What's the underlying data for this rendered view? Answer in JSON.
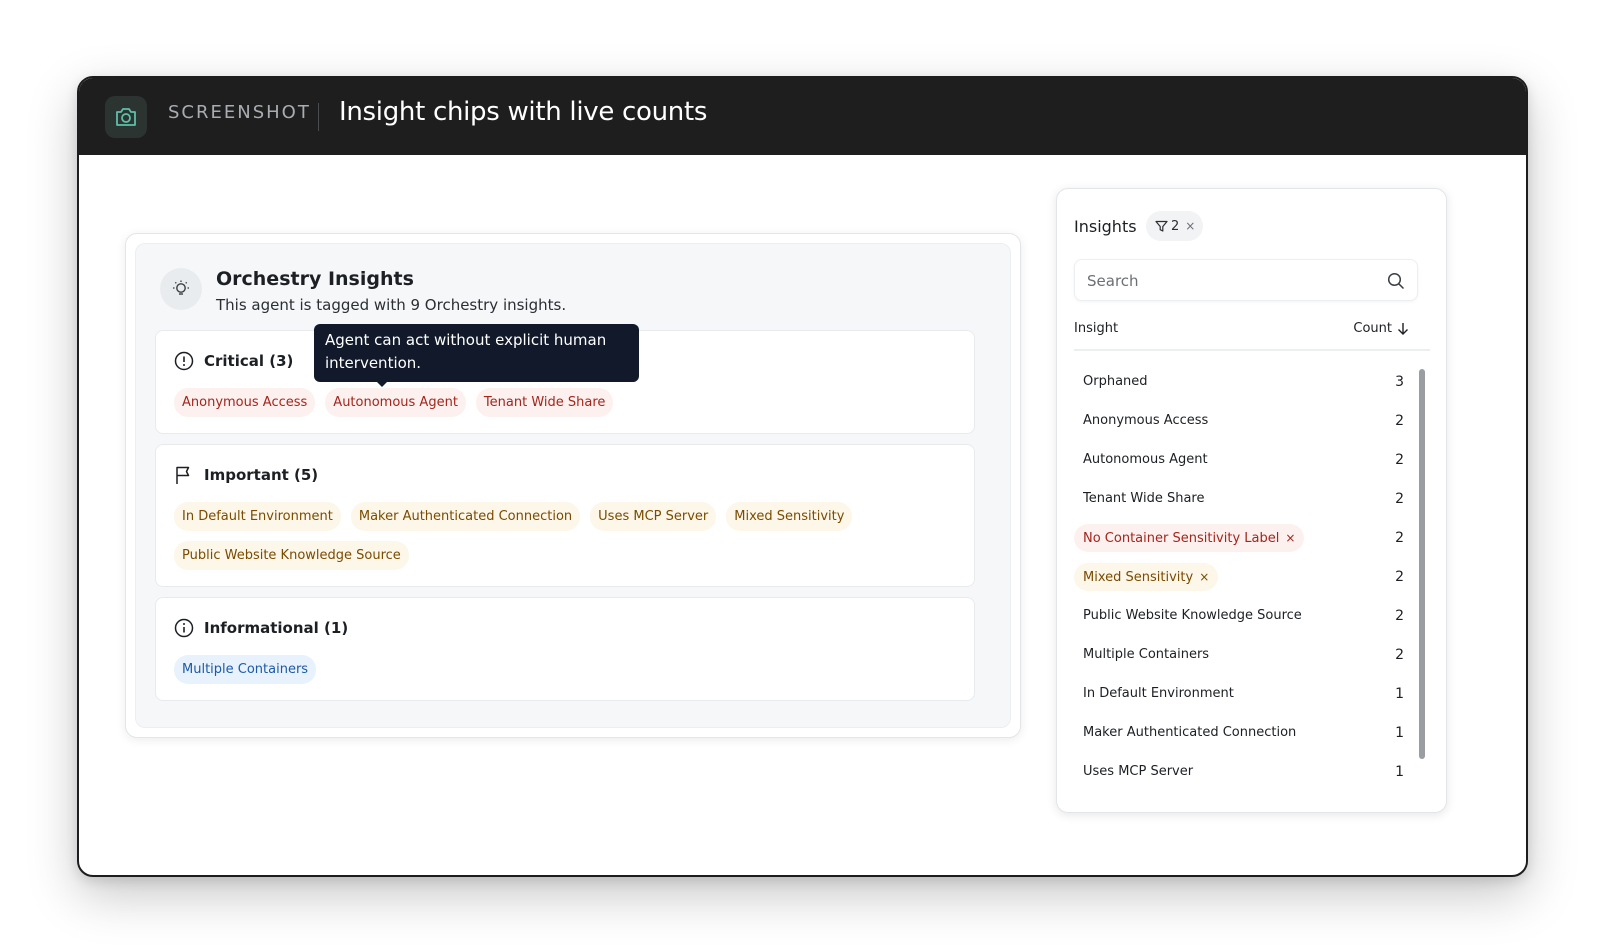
{
  "titlebar": {
    "label": "SCREENSHOT",
    "title": "Insight chips with live counts"
  },
  "orchestry": {
    "title": "Orchestry Insights",
    "subtitle": "This agent is tagged with 9 Orchestry insights.",
    "tooltip": "Agent can act without explicit human intervention.",
    "sections": {
      "critical": {
        "label": "Critical (3)",
        "chips": [
          "Anonymous Access",
          "Autonomous Agent",
          "Tenant Wide Share"
        ]
      },
      "important": {
        "label": "Important (5)",
        "chips": [
          "In Default Environment",
          "Maker Authenticated Connection",
          "Uses MCP Server",
          "Mixed Sensitivity",
          "Public Website Knowledge Source"
        ]
      },
      "informational": {
        "label": "Informational (1)",
        "chips": [
          "Multiple Containers"
        ]
      }
    }
  },
  "insights_panel": {
    "title": "Insights",
    "filter_count": "2",
    "filter_clear": "×",
    "search_placeholder": "Search",
    "col_insight": "Insight",
    "col_count": "Count",
    "rows": [
      {
        "name": "Orphaned",
        "count": "3"
      },
      {
        "name": "Anonymous Access",
        "count": "2"
      },
      {
        "name": "Autonomous Agent",
        "count": "2"
      },
      {
        "name": "Tenant Wide Share",
        "count": "2"
      },
      {
        "name": "No Container Sensitivity Label",
        "count": "2"
      },
      {
        "name": "Mixed Sensitivity",
        "count": "2"
      },
      {
        "name": "Public Website Knowledge Source",
        "count": "2"
      },
      {
        "name": "Multiple Containers",
        "count": "2"
      },
      {
        "name": "In Default Environment",
        "count": "1"
      },
      {
        "name": "Maker Authenticated Connection",
        "count": "1"
      },
      {
        "name": "Uses MCP Server",
        "count": "1"
      }
    ],
    "remove_glyph": "×"
  },
  "colors": {
    "critical_bg": "#fdf1ef",
    "critical_text": "#a4251c",
    "important_bg": "#fdf7ea",
    "important_text": "#7a4b00",
    "info_bg": "#e8f2fc",
    "info_text": "#1c5aa6",
    "tooltip_bg": "#11192a",
    "titlebar_bg": "#1e1e1f"
  }
}
